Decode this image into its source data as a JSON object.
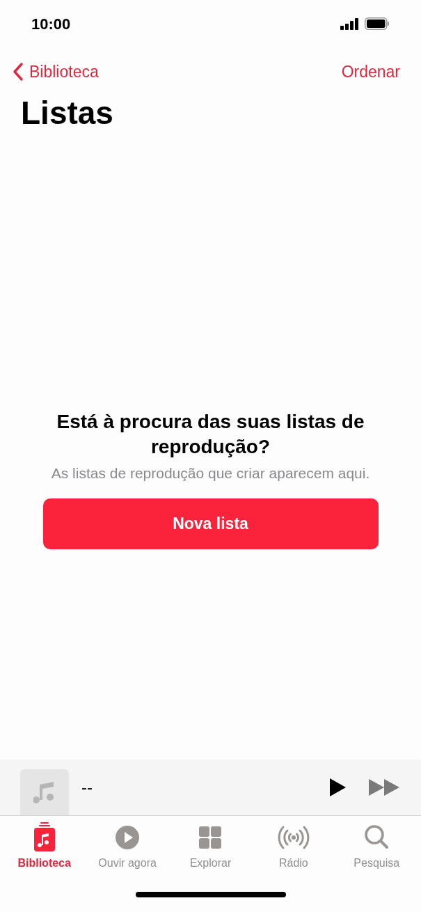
{
  "status_bar": {
    "time": "10:00"
  },
  "nav": {
    "back": "Biblioteca",
    "action": "Ordenar"
  },
  "title": "Listas",
  "empty_state": {
    "heading": "Está à procura das suas listas de reprodução?",
    "text": "As listas de reprodução que criar aparecem aqui.",
    "button": "Nova lista"
  },
  "mini_player": {
    "title": "--"
  },
  "tabs": [
    {
      "label": "Biblioteca",
      "kind": "library",
      "selected": true
    },
    {
      "label": "Ouvir agora",
      "kind": "listen",
      "selected": false
    },
    {
      "label": "Explorar",
      "kind": "browse",
      "selected": false
    },
    {
      "label": "Rádio",
      "kind": "radio",
      "selected": false
    },
    {
      "label": "Pesquisa",
      "kind": "search",
      "selected": false
    }
  ]
}
